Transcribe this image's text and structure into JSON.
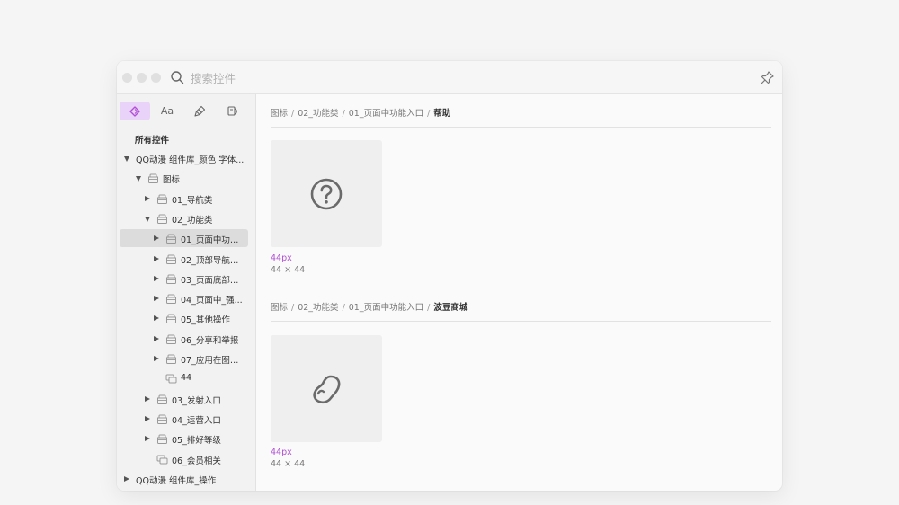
{
  "search": {
    "placeholder": "搜索控件"
  },
  "colors": {
    "accent": "#b14fd6",
    "tab_active_bg": "#ead3f8"
  },
  "sidebar": {
    "tabs": [
      {
        "name": "symbols-tab",
        "icon": "diamond-icon"
      },
      {
        "name": "text-styles-tab",
        "label": "Aa"
      },
      {
        "name": "brush-tab",
        "icon": "brush-icon"
      },
      {
        "name": "fill-tab",
        "icon": "paint-bucket-icon"
      }
    ],
    "all_label": "所有控件",
    "tree": [
      {
        "label": "QQ动漫 组件库_颜色 字体...",
        "depth": 0,
        "expanded": true,
        "folder": false
      },
      {
        "label": "图标",
        "depth": 1,
        "expanded": true,
        "folder": true
      },
      {
        "label": "01_导航类",
        "depth": 2,
        "expanded": false,
        "folder": true
      },
      {
        "label": "02_功能类",
        "depth": 2,
        "expanded": true,
        "folder": true
      },
      {
        "label": "01_页面中功能...",
        "depth": 3,
        "expanded": false,
        "folder": true,
        "selected": true
      },
      {
        "label": "02_顶部导航栏...",
        "depth": 3,
        "expanded": false,
        "folder": true
      },
      {
        "label": "03_页面底部中...",
        "depth": 3,
        "expanded": false,
        "folder": true
      },
      {
        "label": "04_页面中_强...",
        "depth": 3,
        "expanded": false,
        "folder": true
      },
      {
        "label": "05_其他操作",
        "depth": 3,
        "expanded": false,
        "folder": true
      },
      {
        "label": "06_分享和举报",
        "depth": 3,
        "expanded": false,
        "folder": true
      },
      {
        "label": "07_应用在图片...",
        "depth": 3,
        "expanded": false,
        "folder": true
      },
      {
        "label": "44",
        "depth": 3,
        "leaf": true
      },
      {
        "label": "03_发射入口",
        "depth": 2,
        "expanded": false,
        "folder": true
      },
      {
        "label": "04_运营入口",
        "depth": 2,
        "expanded": false,
        "folder": true
      },
      {
        "label": "05_排好等级",
        "depth": 2,
        "expanded": false,
        "folder": true
      },
      {
        "label": "06_会员相关",
        "depth": 2,
        "leaf": true
      },
      {
        "label": "QQ动漫 组件库_操作",
        "depth": 0,
        "expanded": false,
        "folder": false
      }
    ]
  },
  "main": {
    "sections": [
      {
        "breadcrumb": [
          "图标",
          "02_功能类",
          "01_页面中功能入口"
        ],
        "current": "帮助",
        "icon": "help-circle-icon",
        "size_label": "44px",
        "dimensions": "44 × 44"
      },
      {
        "breadcrumb": [
          "图标",
          "02_功能类",
          "01_页面中功能入口"
        ],
        "current": "波豆商城",
        "icon": "bean-icon",
        "size_label": "44px",
        "dimensions": "44 × 44"
      }
    ]
  }
}
